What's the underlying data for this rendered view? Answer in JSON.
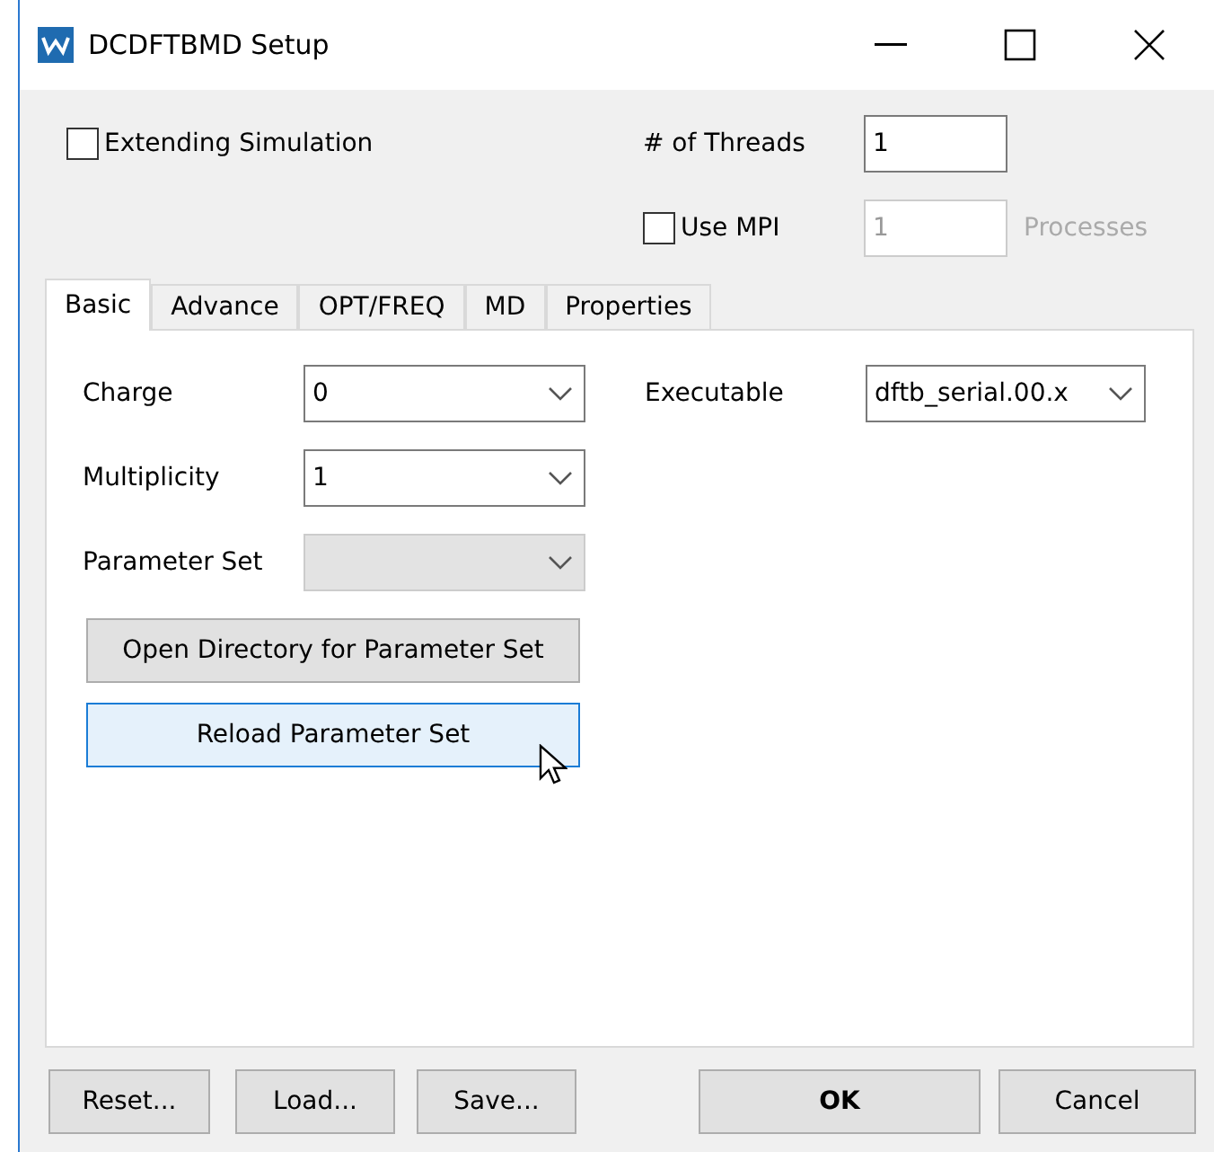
{
  "window": {
    "title": "DCDFTBMD Setup"
  },
  "extending_simulation": {
    "label": "Extending Simulation",
    "checked": false
  },
  "threads": {
    "label": "# of Threads",
    "value": "1"
  },
  "use_mpi": {
    "label": "Use MPI",
    "checked": false,
    "value": "1",
    "unit": "Processes",
    "disabled": true
  },
  "tabs": [
    {
      "label": "Basic",
      "selected": true
    },
    {
      "label": "Advance",
      "selected": false
    },
    {
      "label": "OPT/FREQ",
      "selected": false
    },
    {
      "label": "MD",
      "selected": false
    },
    {
      "label": "Properties",
      "selected": false
    }
  ],
  "fields": [
    {
      "label": "Charge",
      "value": "0",
      "disabled": false
    },
    {
      "label": "Multiplicity",
      "value": "1",
      "disabled": false
    },
    {
      "label": "Parameter Set",
      "disabled": true
    }
  ],
  "executable": {
    "label": "Executable",
    "value": "dftb_serial.00.x"
  },
  "panel_buttons": [
    {
      "label": "Open Directory for Parameter Set",
      "hovered": false
    },
    {
      "label": "Reload Parameter Set",
      "hovered": true
    }
  ],
  "footer_buttons": [
    {
      "label": "Reset...",
      "default": false
    },
    {
      "label": "Load...",
      "default": false
    },
    {
      "label": "Save...",
      "default": false
    },
    {
      "label": "OK",
      "default": true
    },
    {
      "label": "Cancel",
      "default": false
    }
  ]
}
